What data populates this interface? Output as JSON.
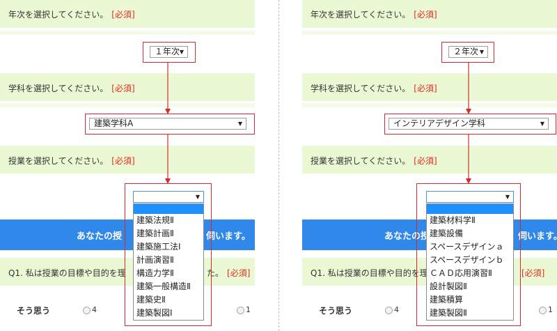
{
  "required_label": "[必須]",
  "prompts": {
    "year": "年次を選択してください。",
    "department": "学科を選択してください。",
    "course": "授業を選択してください。"
  },
  "banner": {
    "left_visible": "あなたの授",
    "right_visible": "伺います。"
  },
  "question": {
    "left_visible": "Q1.  私は授業の目標や目的を理",
    "right_visible": "た。"
  },
  "scale": {
    "agree_label": "そう思う",
    "option_4": "4",
    "option_1": "1"
  },
  "left": {
    "year_value": "１年次",
    "department_value": "建築学科A",
    "course_options": [
      "建築法規Ⅱ",
      "建築計画Ⅱ",
      "建築施工法Ⅰ",
      "計画演習Ⅱ",
      "構造力学Ⅱ",
      "建築一般構造Ⅱ",
      "建築史Ⅱ",
      "建築製図Ⅰ"
    ]
  },
  "right": {
    "year_value": "２年次",
    "department_value": "インテリアデザイン学科",
    "course_options": [
      "建築材料学Ⅱ",
      "建築設備",
      "スペースデザインａ",
      "スペースデザインｂ",
      "ＣＡＤ応用演習Ⅱ",
      "設計製図Ⅱ",
      "建築積算",
      "建築製図Ⅱ"
    ]
  },
  "colors": {
    "band": "#ebf8d4",
    "banner": "#2f88ea",
    "highlight_box": "#d42a2a",
    "required": "#e8271f",
    "selected_option": "#1e90ff"
  },
  "icons": {
    "select_arrow": "triangle-down-icon",
    "radio": "radio-button-icon"
  }
}
